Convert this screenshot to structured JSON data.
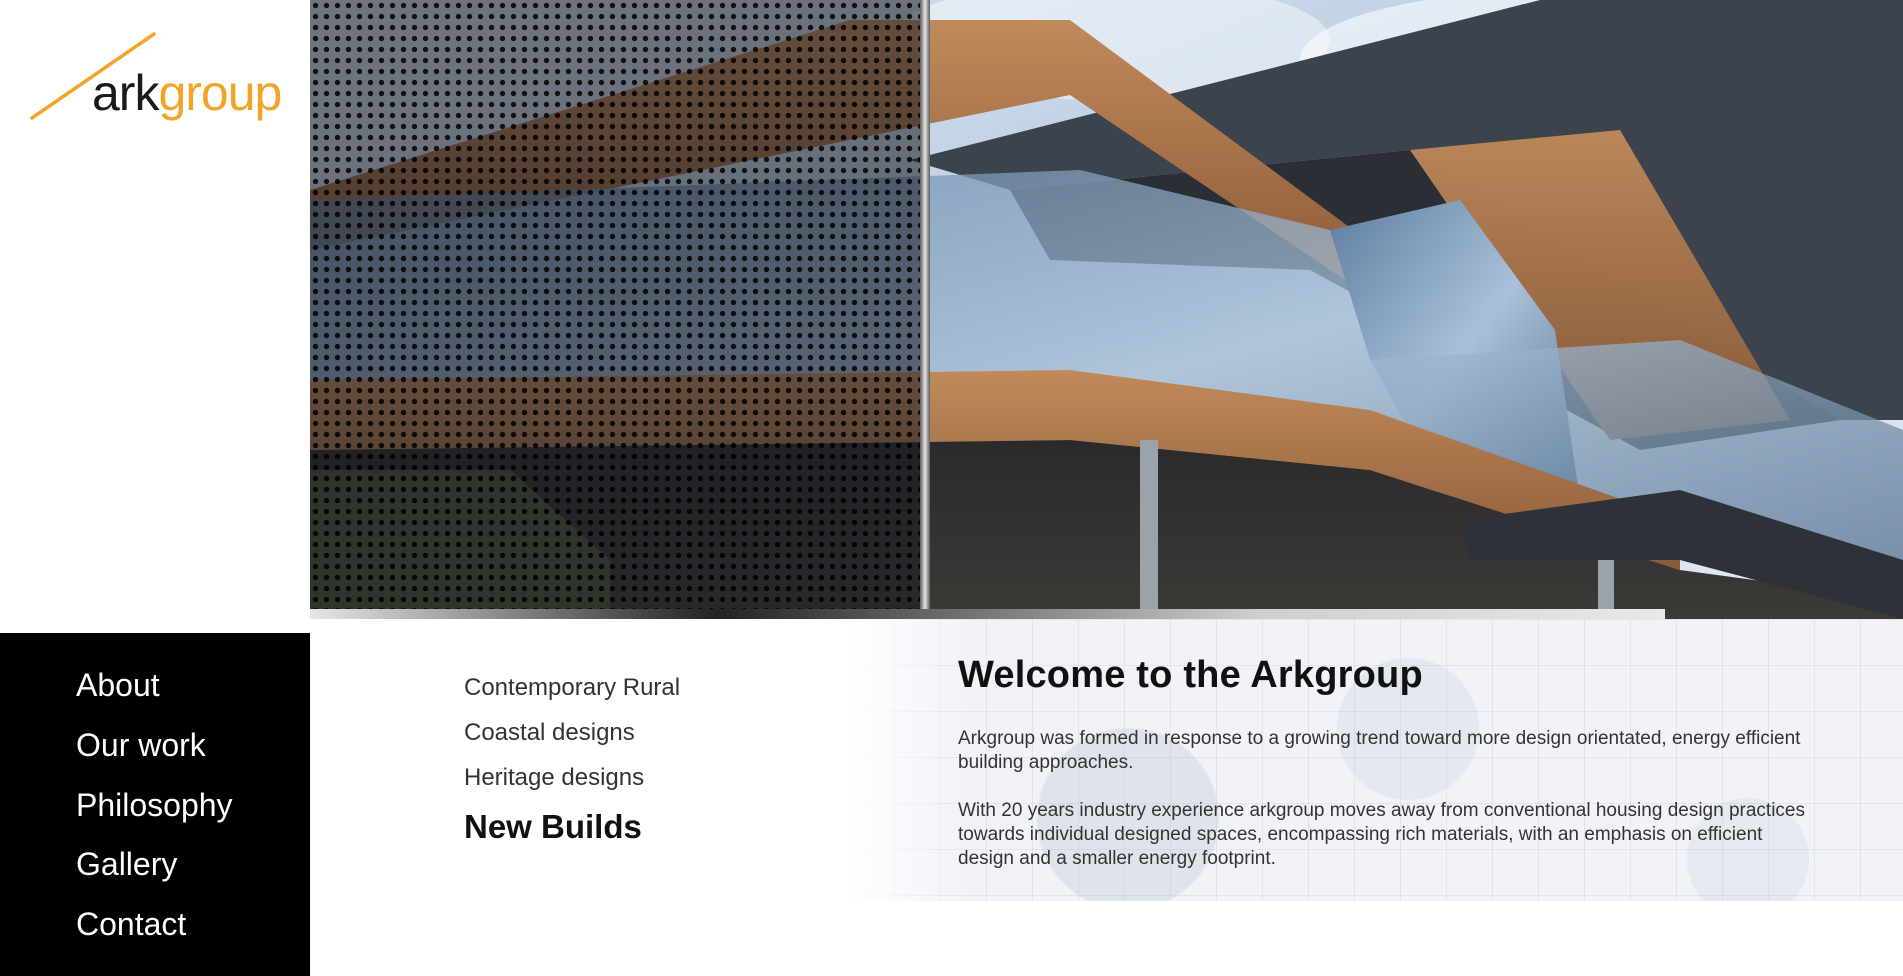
{
  "logo": {
    "part1": "ark",
    "part2": "group",
    "slash_color": "#f2a428"
  },
  "hero": {
    "image_alt_icon": "building-photo"
  },
  "nav": {
    "items": [
      {
        "label": "About"
      },
      {
        "label": "Our work"
      },
      {
        "label": "Philosophy"
      },
      {
        "label": "Gallery"
      },
      {
        "label": "Contact"
      }
    ]
  },
  "submenu": {
    "items": [
      {
        "label": "Contemporary Rural"
      },
      {
        "label": "Coastal designs"
      },
      {
        "label": "Heritage designs"
      },
      {
        "label": "New Builds",
        "active": true
      }
    ]
  },
  "welcome": {
    "title": "Welcome to the Arkgroup",
    "paragraphs": [
      "Arkgroup was formed in response to a growing trend toward more design orientated, energy efficient building approaches.",
      "With 20 years industry experience arkgroup moves away from conventional housing design practices towards individual designed spaces, encompassing rich materials, with an emphasis on efficient design and a smaller energy footprint."
    ]
  },
  "colors": {
    "accent": "#f2a428",
    "sidebar_bg": "#000000",
    "text": "#333333"
  }
}
